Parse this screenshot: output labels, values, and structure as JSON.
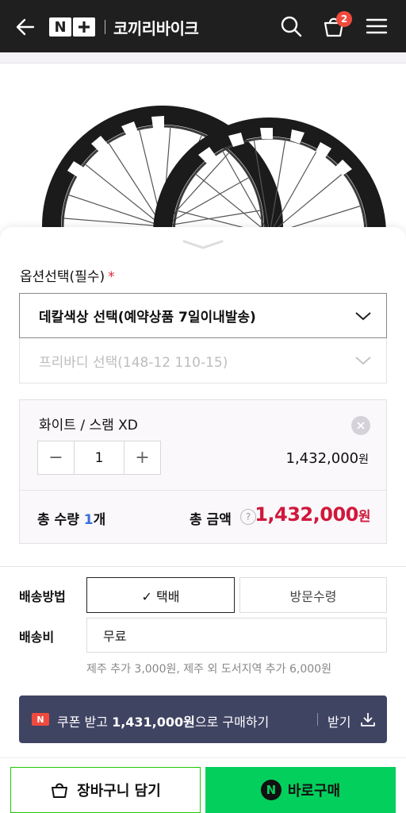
{
  "header": {
    "logo_text": "N",
    "store_name": "코끼리바이크",
    "cart_count": "2",
    "icons": [
      "back-arrow-icon",
      "search-icon",
      "cart-icon",
      "menu-icon"
    ]
  },
  "options": {
    "title": "옵션선택(필수)",
    "required_mark": "*",
    "select1": "데칼색상 선택(예약상품 7일이내발송)",
    "select2": "프리바디 선택(148-12 110-15)"
  },
  "selected_item": {
    "name": "화이트 / 스램 XD",
    "quantity": "1",
    "minus": "−",
    "plus": "+",
    "price": "1,432,000",
    "price_unit": "원"
  },
  "totals": {
    "qty_label": "총 수량 ",
    "qty_value": "1",
    "qty_unit": "개",
    "amount_label": "총 금액",
    "help": "?",
    "amount": "1,432,000",
    "amount_unit": "원"
  },
  "shipping": {
    "method_label": "배송방법",
    "option_parcel": "✓ 택배",
    "option_visit": "방문수령",
    "fee_label": "배송비",
    "fee_value": "무료",
    "fee_note": "제주 추가 3,000원, 제주 외 도서지역 추가 6,000원"
  },
  "coupon": {
    "badge": "N",
    "text_prefix": "쿠폰 받고 ",
    "text_amount": "1,431,000원",
    "text_suffix": "으로 구매하기",
    "receive_label": "받기"
  },
  "actions": {
    "cart_label": "장바구니 담기",
    "buy_label": "바로구매",
    "buy_icon_text": "N"
  },
  "colors": {
    "header_bg": "#1f1f1f",
    "accent_red": "#d0183b",
    "naver_green": "#03cf5d",
    "coupon_bg": "#404463"
  }
}
